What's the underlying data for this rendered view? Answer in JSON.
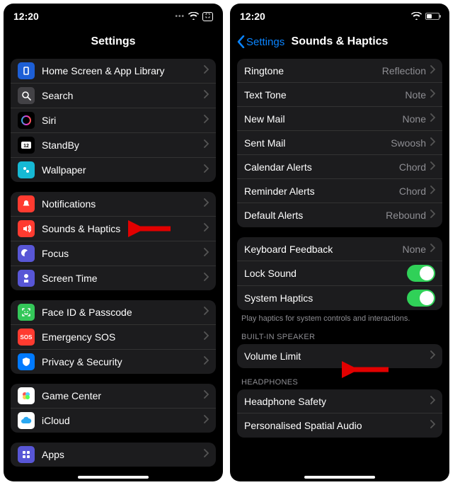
{
  "left": {
    "time": "12:20",
    "title": "Settings",
    "groups": [
      [
        {
          "icon": "home-app",
          "bg": "#1d5fd6",
          "label": "Home Screen & App Library"
        },
        {
          "icon": "search",
          "bg": "#434246",
          "label": "Search"
        },
        {
          "icon": "siri",
          "bg": "#000",
          "label": "Siri"
        },
        {
          "icon": "standby",
          "bg": "#000",
          "label": "StandBy"
        },
        {
          "icon": "wallpaper",
          "bg": "#16b9d4",
          "label": "Wallpaper"
        }
      ],
      [
        {
          "icon": "notifications",
          "bg": "#ff3b30",
          "label": "Notifications"
        },
        {
          "icon": "sounds",
          "bg": "#ff3b30",
          "label": "Sounds & Haptics"
        },
        {
          "icon": "focus",
          "bg": "#5856d6",
          "label": "Focus"
        },
        {
          "icon": "screentime",
          "bg": "#5856d6",
          "label": "Screen Time"
        }
      ],
      [
        {
          "icon": "faceid",
          "bg": "#34c759",
          "label": "Face ID & Passcode"
        },
        {
          "icon": "sos",
          "bg": "#ff3b30",
          "label": "Emergency SOS",
          "text": "SOS"
        },
        {
          "icon": "privacy",
          "bg": "#007aff",
          "label": "Privacy & Security"
        }
      ],
      [
        {
          "icon": "gamecenter",
          "bg": "#fff",
          "label": "Game Center"
        },
        {
          "icon": "icloud",
          "bg": "#fff",
          "label": "iCloud"
        }
      ],
      [
        {
          "icon": "apps",
          "bg": "#5856d6",
          "label": "Apps"
        }
      ]
    ]
  },
  "right": {
    "time": "12:20",
    "back": "Settings",
    "title": "Sounds & Haptics",
    "soundRows": [
      {
        "label": "Ringtone",
        "value": "Reflection"
      },
      {
        "label": "Text Tone",
        "value": "Note"
      },
      {
        "label": "New Mail",
        "value": "None"
      },
      {
        "label": "Sent Mail",
        "value": "Swoosh"
      },
      {
        "label": "Calendar Alerts",
        "value": "Chord"
      },
      {
        "label": "Reminder Alerts",
        "value": "Chord"
      },
      {
        "label": "Default Alerts",
        "value": "Rebound"
      }
    ],
    "feedbackRows": [
      {
        "label": "Keyboard Feedback",
        "value": "None",
        "type": "link"
      },
      {
        "label": "Lock Sound",
        "type": "toggle",
        "on": true
      },
      {
        "label": "System Haptics",
        "type": "toggle",
        "on": true
      }
    ],
    "hapticsFooter": "Play haptics for system controls and interactions.",
    "builtInHeader": "BUILT-IN SPEAKER",
    "volumeLimit": "Volume Limit",
    "headphonesHeader": "HEADPHONES",
    "headphoneRows": [
      {
        "label": "Headphone Safety"
      },
      {
        "label": "Personalised Spatial Audio"
      }
    ]
  }
}
